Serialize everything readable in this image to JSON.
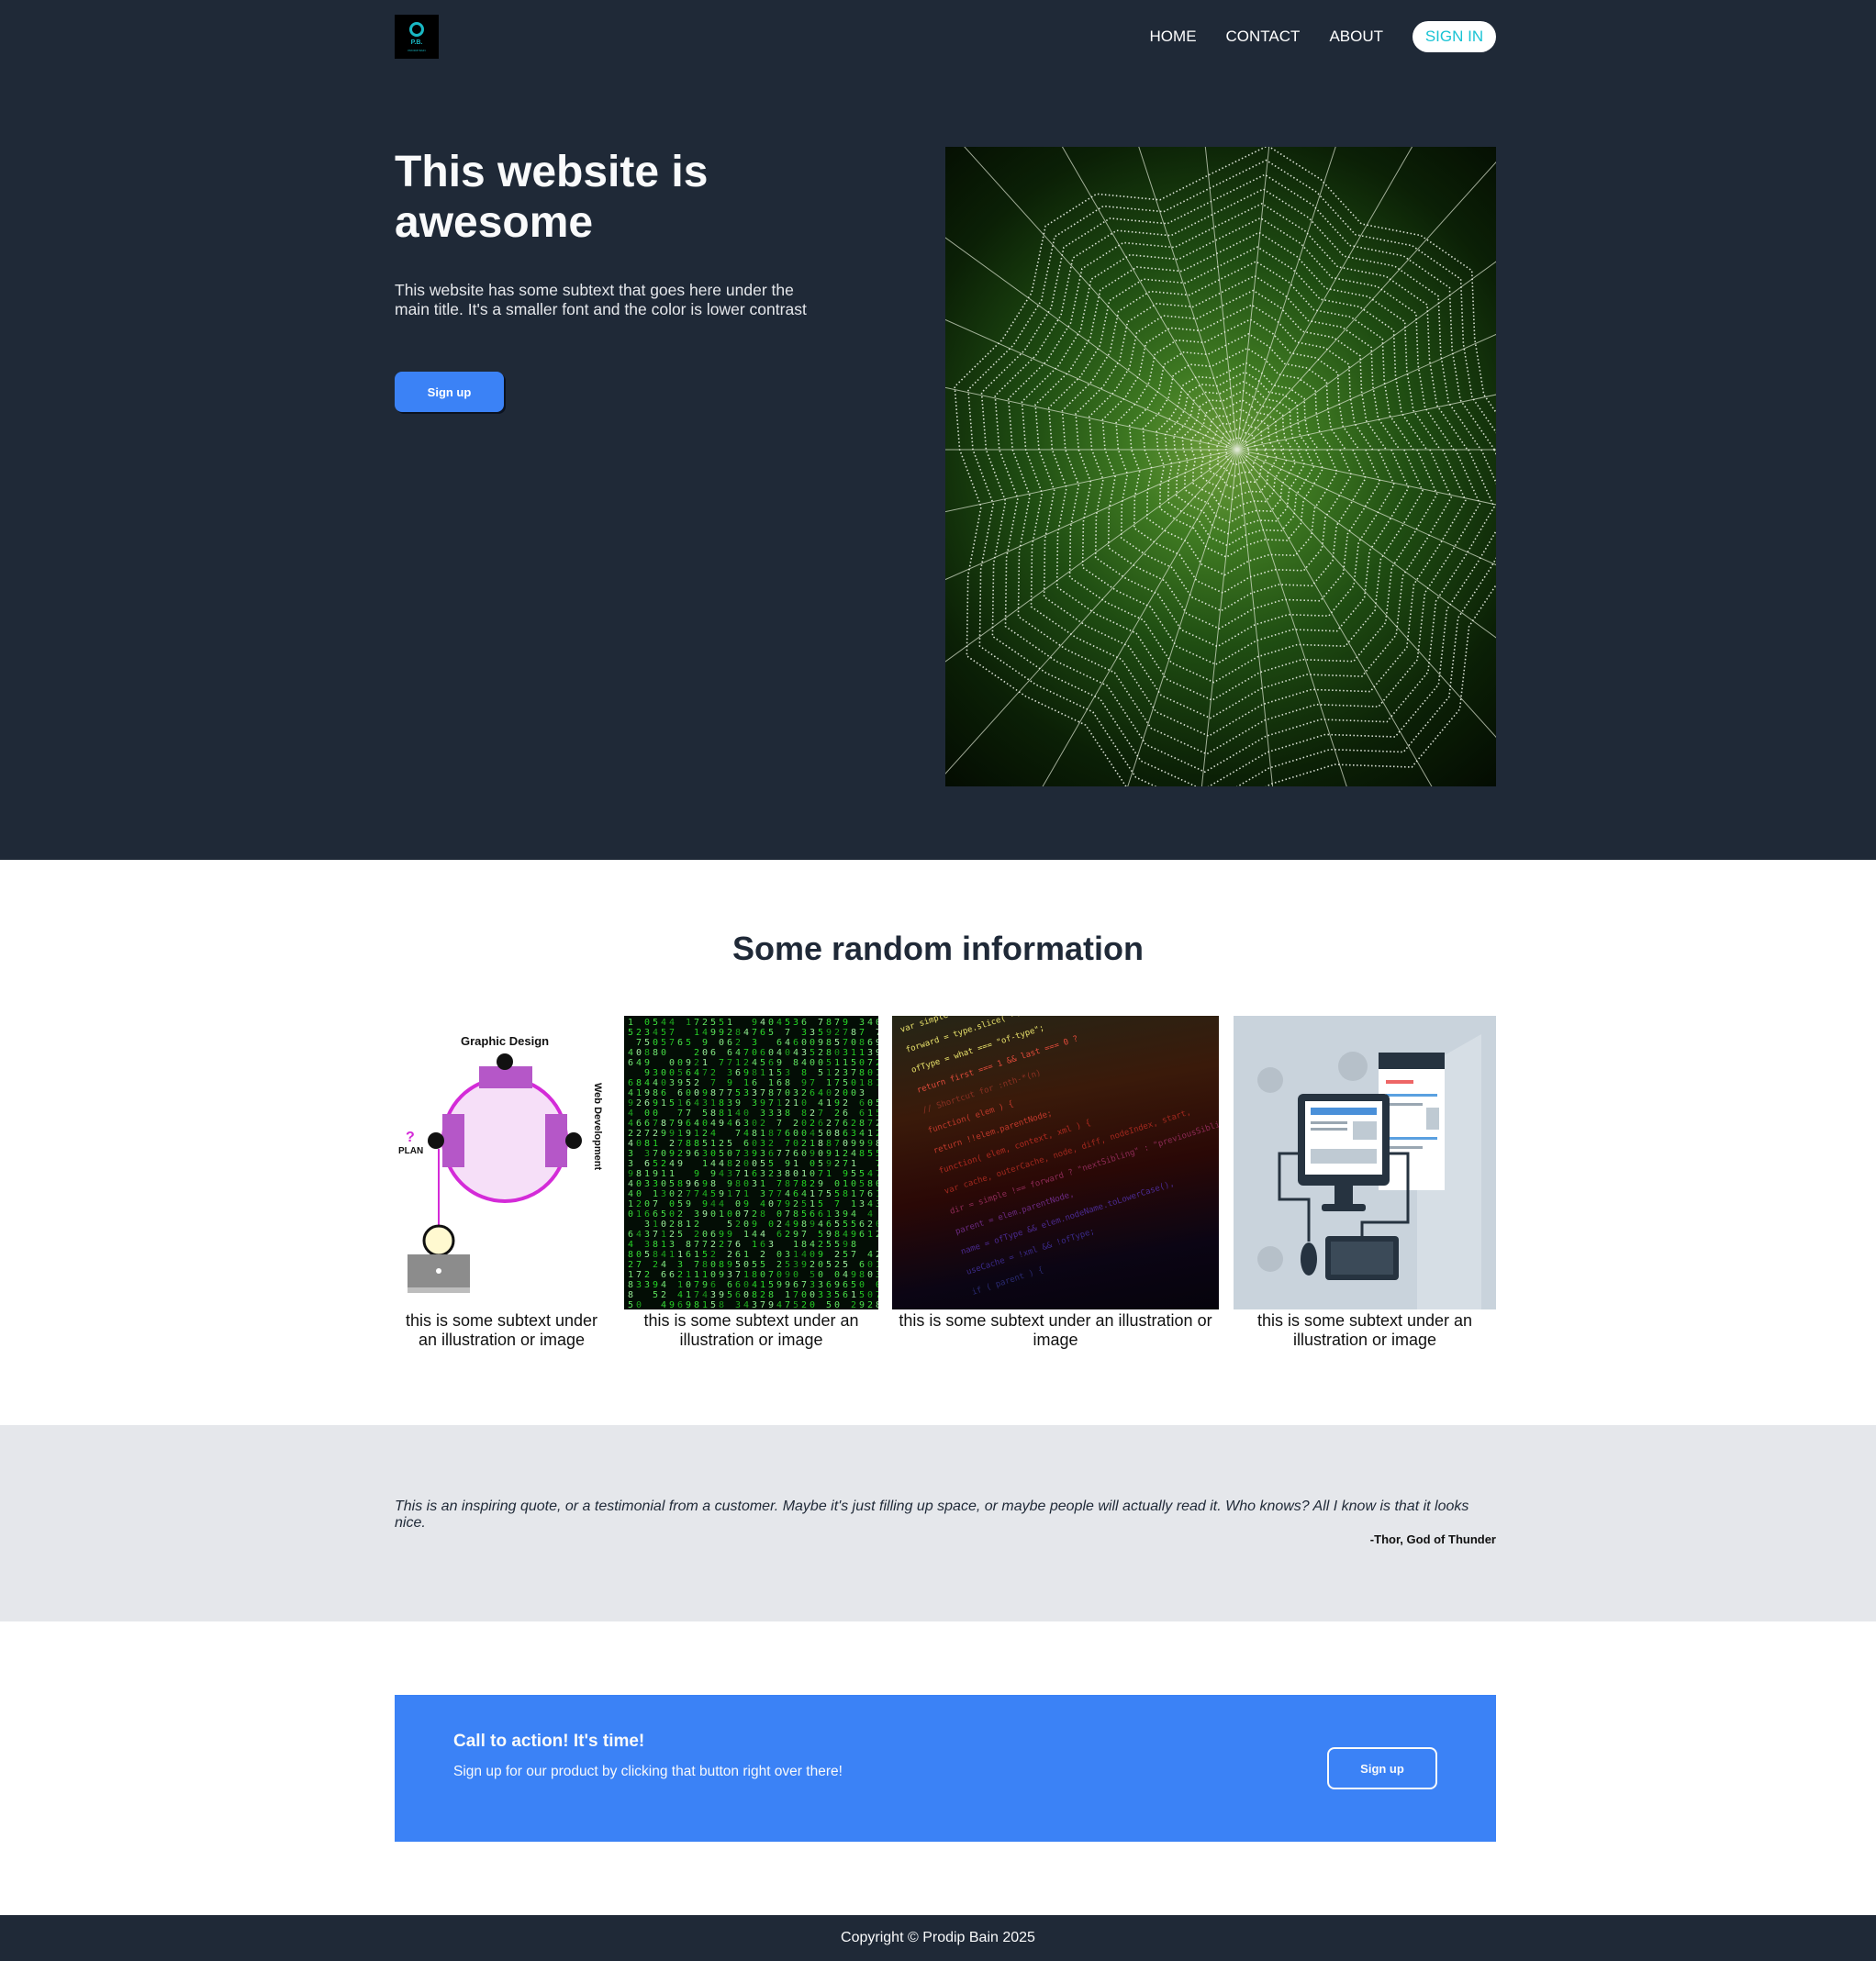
{
  "header": {
    "logo_monogram": "P.B.",
    "logo_subtext": "PRODIP BAIN",
    "nav": [
      "HOME",
      "CONTACT",
      "ABOUT"
    ],
    "sign_in": "SIGN IN"
  },
  "hero": {
    "title": "This website is awesome",
    "subtext": "This website has some subtext that goes here under the main title. It's a smaller font and the color is lower contrast",
    "button": "Sign up",
    "image": "spider-web-photo"
  },
  "features": {
    "title": "Some random information",
    "cards": [
      {
        "image": "graphic-design-illustration",
        "caption": "this is some subtext under an illustration or image",
        "labels": {
          "top": "Graphic Design",
          "left_mark": "?",
          "left": "PLAN",
          "right": "Web Development"
        }
      },
      {
        "image": "matrix-code-photo",
        "caption": "this is some subtext under an illustration or image"
      },
      {
        "image": "code-editor-photo",
        "caption": "this is some subtext under an illustration or image",
        "code_lines": [
          "var simple = type.slice(",
          "forward = type.slice( -4",
          "ofType = what === \"of-type\";",
          "return first === 1 && last === 0 ?",
          "// Shortcut for :nth-*(n)",
          "function( elem ) {",
          "return !!elem.parentNode;",
          "function( elem, context, xml ) {",
          "var cache, outerCache, node, diff, nodeIndex, start,",
          "dir = simple !== forward ? \"nextSibling\" : \"previousSibling\",",
          "parent = elem.parentNode,",
          "name = ofType && elem.nodeName.toLowerCase(),",
          "useCache = !xml && !ofType;",
          "if ( parent ) {"
        ]
      },
      {
        "image": "web-development-illustration",
        "caption": "this is some subtext under an illustration or image"
      }
    ]
  },
  "quote": {
    "text": "This is an inspiring quote, or a testimonial from a customer. Maybe it's just filling up space, or maybe people will actually read it. Who knows? All I know is that it looks nice.",
    "author": "-Thor, God of Thunder"
  },
  "cta": {
    "title": "Call to action! It's time!",
    "text": "Sign up for our product by clicking that button right over there!",
    "button": "Sign up"
  },
  "footer": {
    "copyright": "Copyright © Prodip Bain 2025"
  },
  "colors": {
    "dark": "#1f2937",
    "accent_blue": "#3b82f6",
    "accent_teal": "#19c3d4",
    "light_gray": "#e5e7eb"
  }
}
